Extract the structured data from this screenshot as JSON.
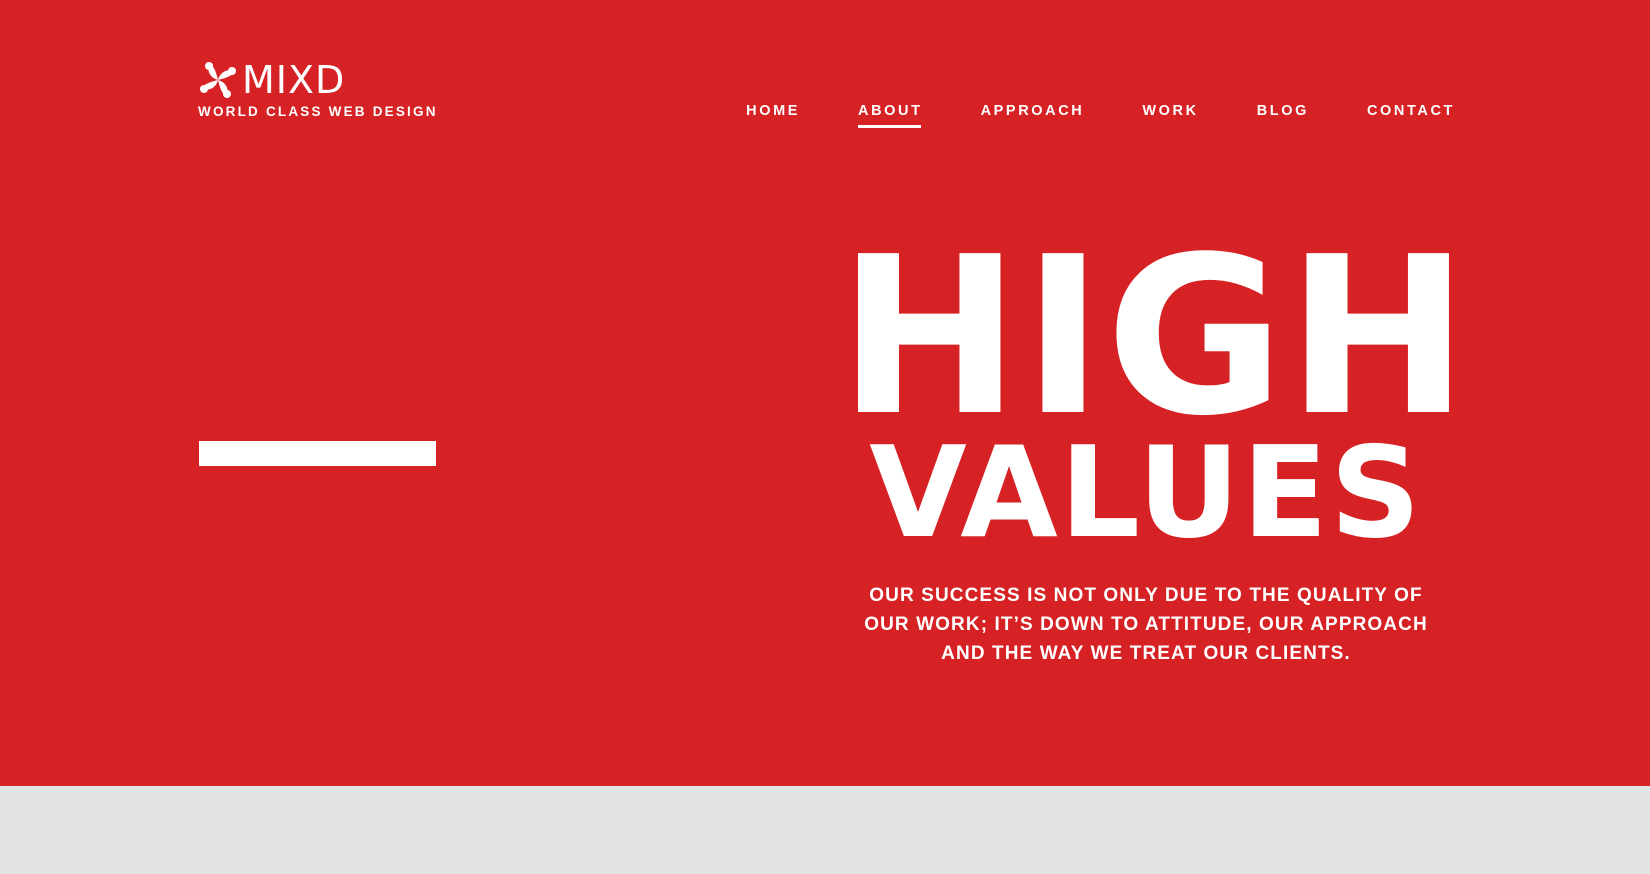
{
  "brand": {
    "logo_text": "MIXD",
    "tagline": "WORLD CLASS WEB DESIGN",
    "logo_icon": "pinwheel-icon"
  },
  "nav": {
    "items": [
      {
        "label": "HOME",
        "active": false
      },
      {
        "label": "ABOUT",
        "active": true
      },
      {
        "label": "APPROACH",
        "active": false
      },
      {
        "label": "WORK",
        "active": false
      },
      {
        "label": "BLOG",
        "active": false
      },
      {
        "label": "CONTACT",
        "active": false
      }
    ]
  },
  "hero": {
    "headline_line1": "HIGH",
    "headline_line2": "VALUES",
    "lede": "OUR SUCCESS IS NOT ONLY DUE TO THE QUALITY OF OUR WORK; IT’S DOWN TO ATTITUDE, OUR APPROACH AND THE WAY WE TREAT OUR CLIENTS."
  },
  "colors": {
    "hero_background": "#d62224",
    "text": "#ffffff",
    "below_fold": "#e3e3e3"
  }
}
